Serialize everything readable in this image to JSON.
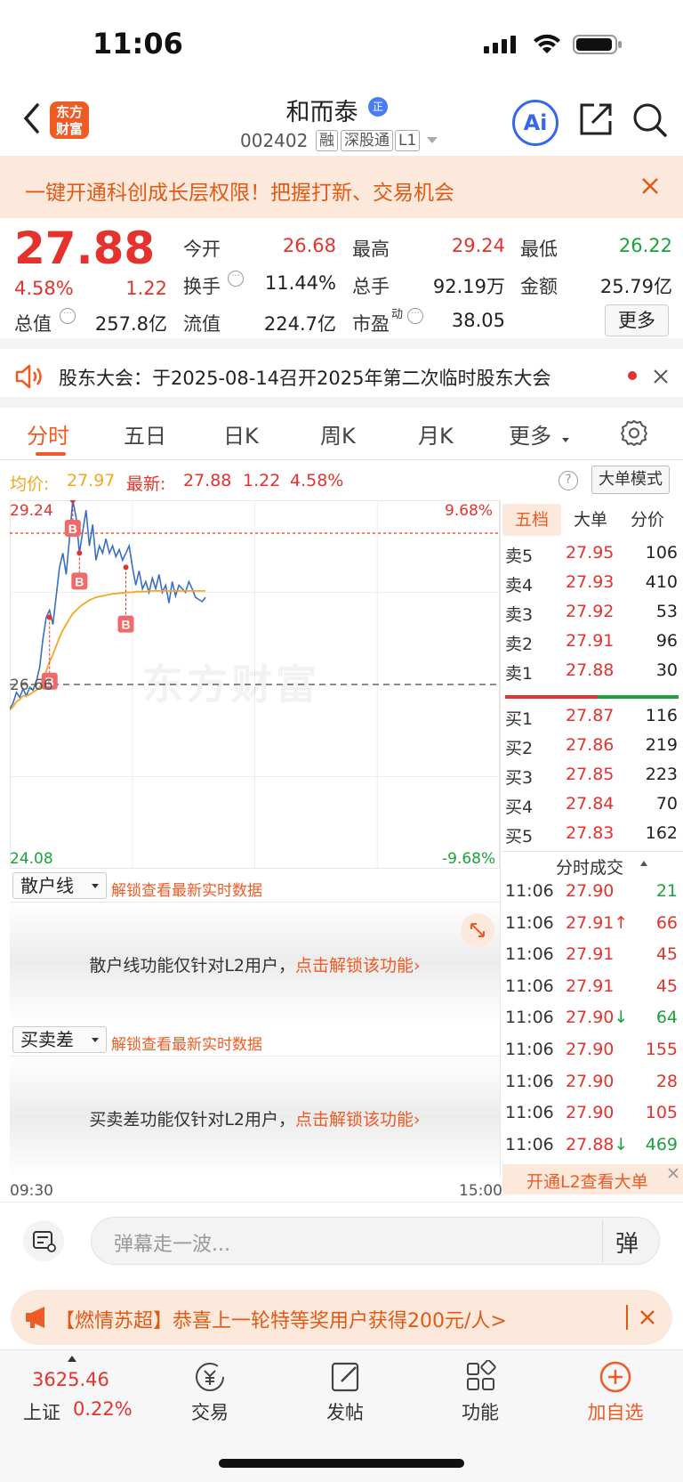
{
  "status_bar": {
    "time": "11:06"
  },
  "header": {
    "logo_text": "东方财富",
    "stock_name": "和而泰",
    "stock_code": "002402",
    "tags": [
      "融",
      "深股通",
      "L1"
    ],
    "zheng_badge": "正",
    "ai_label": "Ai"
  },
  "banner": {
    "text": "一键开通科创成长层权限！把握打新、交易机会"
  },
  "quote": {
    "price": "27.88",
    "change_pct": "4.58%",
    "change": "1.22",
    "fields": [
      {
        "label": "今开",
        "value": "26.68",
        "color": "#e5322d"
      },
      {
        "label": "最高",
        "value": "29.24",
        "color": "#e5322d"
      },
      {
        "label": "最低",
        "value": "26.22",
        "color": "#1aa33a"
      },
      {
        "label": "换手",
        "value": "11.44%",
        "color": "#222222"
      },
      {
        "label": "总手",
        "value": "92.19万",
        "color": "#222222"
      },
      {
        "label": "金额",
        "value": "25.79亿",
        "color": "#222222"
      },
      {
        "label": "总值",
        "value": "257.8亿",
        "color": "#222222"
      },
      {
        "label": "流值",
        "value": "224.7亿",
        "color": "#222222"
      },
      {
        "label": "市盈",
        "value": "38.05",
        "color": "#222222"
      }
    ],
    "pe_superscript": "动",
    "more_label": "更多"
  },
  "notice": {
    "text": "股东大会：于2025-08-14召开2025年第二次临时股东大会"
  },
  "tabs": [
    "分时",
    "五日",
    "日K",
    "周K",
    "月K",
    "更多"
  ],
  "chart_header": {
    "avg_label": "均价:",
    "avg_value": "27.97",
    "latest_label": "最新:",
    "latest_value": "27.88",
    "change": "1.22",
    "change_pct": "4.58%",
    "big_order_mode": "大单模式",
    "help": "?"
  },
  "chart_data": {
    "type": "line",
    "title": "",
    "price_high": "29.24",
    "price_low": "24.08",
    "pct_high": "9.68%",
    "pct_low": "-9.68%",
    "prev_close_label": "26.66",
    "x_start": "09:30",
    "x_end": "15:00",
    "watermark": "东方财富",
    "ylim": [
      24.08,
      29.24
    ],
    "prev_close": 26.66,
    "limit_up": 29.24,
    "series": [
      {
        "color": "#3a6fc4",
        "values": [
          26.32,
          26.4,
          26.55,
          26.48,
          26.6,
          26.5,
          26.62,
          26.58,
          26.7,
          26.9,
          27.3,
          27.6,
          27.7,
          27.5,
          27.9,
          28.3,
          28.5,
          28.2,
          28.7,
          29.24,
          29.0,
          28.5,
          28.8,
          29.1,
          28.6,
          28.9,
          28.4,
          28.6,
          28.5,
          28.7,
          28.5,
          28.6,
          28.45,
          28.55,
          28.4,
          28.5,
          28.6,
          28.3,
          28.05,
          28.25,
          28.0,
          28.1,
          27.95,
          28.15,
          28.0,
          28.2,
          27.95,
          28.05,
          27.8,
          28.1,
          27.9,
          28.05,
          28.0,
          27.95,
          28.1,
          28.0,
          27.88,
          27.85,
          27.82,
          27.88
        ]
      },
      {
        "color": "#f5a623",
        "values": [
          26.3,
          26.35,
          26.42,
          26.45,
          26.5,
          26.5,
          26.52,
          26.55,
          26.58,
          26.62,
          26.72,
          26.85,
          26.98,
          27.08,
          27.2,
          27.32,
          27.42,
          27.5,
          27.58,
          27.65,
          27.7,
          27.74,
          27.78,
          27.81,
          27.84,
          27.86,
          27.88,
          27.89,
          27.9,
          27.91,
          27.92,
          27.93,
          27.93,
          27.94,
          27.94,
          27.95,
          27.95,
          27.95,
          27.96,
          27.96,
          27.96,
          27.96,
          27.97,
          27.97,
          27.97,
          27.97,
          27.97,
          27.97,
          27.97,
          27.97,
          27.97,
          27.97,
          27.97,
          27.97,
          27.97,
          27.97,
          27.97,
          27.97,
          27.97,
          27.97
        ]
      }
    ],
    "buy_markers": [
      {
        "index": 12,
        "price": 27.6,
        "label": "B"
      },
      {
        "index": 19,
        "price": 29.24,
        "label": "B"
      },
      {
        "index": 21,
        "price": 28.5,
        "label": "B"
      },
      {
        "index": 35,
        "price": 28.3,
        "label": "B"
      }
    ]
  },
  "orderbook": {
    "tabs": [
      "五档",
      "大单",
      "分价"
    ],
    "asks": [
      {
        "label": "卖5",
        "price": "27.95",
        "vol": "106"
      },
      {
        "label": "卖4",
        "price": "27.93",
        "vol": "410"
      },
      {
        "label": "卖3",
        "price": "27.92",
        "vol": "53"
      },
      {
        "label": "卖2",
        "price": "27.91",
        "vol": "96"
      },
      {
        "label": "卖1",
        "price": "27.88",
        "vol": "30"
      }
    ],
    "bids": [
      {
        "label": "买1",
        "price": "27.87",
        "vol": "116"
      },
      {
        "label": "买2",
        "price": "27.86",
        "vol": "219"
      },
      {
        "label": "买3",
        "price": "27.85",
        "vol": "223"
      },
      {
        "label": "买4",
        "price": "27.84",
        "vol": "70"
      },
      {
        "label": "买5",
        "price": "27.83",
        "vol": "162"
      }
    ]
  },
  "trades": {
    "title": "分时成交",
    "rows": [
      {
        "time": "11:06",
        "price": "27.90",
        "vol": "21",
        "color": "#1aa33a"
      },
      {
        "time": "11:06",
        "price": "27.91↑",
        "vol": "66",
        "color": "#e5322d"
      },
      {
        "time": "11:06",
        "price": "27.91",
        "vol": "45",
        "color": "#e5322d"
      },
      {
        "time": "11:06",
        "price": "27.91",
        "vol": "45",
        "color": "#e5322d"
      },
      {
        "time": "11:06",
        "price": "27.90↓",
        "vol": "64",
        "color": "#1aa33a"
      },
      {
        "time": "11:06",
        "price": "27.90",
        "vol": "155",
        "color": "#e5322d"
      },
      {
        "time": "11:06",
        "price": "27.90",
        "vol": "28",
        "color": "#e5322d"
      },
      {
        "time": "11:06",
        "price": "27.90",
        "vol": "105",
        "color": "#e5322d"
      },
      {
        "time": "11:06",
        "price": "27.88↓",
        "vol": "469",
        "color": "#1aa33a"
      }
    ],
    "l2_label": "开通L2查看大单"
  },
  "sub_panels": [
    {
      "selector": "散户线",
      "unlock": "解锁查看最新实时数据",
      "msg": "散户线功能仅针对L2用户，",
      "link": "点击解锁该功能"
    },
    {
      "selector": "买卖差",
      "unlock": "解锁查看最新实时数据",
      "msg": "买卖差功能仅针对L2用户，",
      "link": "点击解锁该功能"
    }
  ],
  "danmu": {
    "placeholder": "弹幕走一波...",
    "button": "弹"
  },
  "promo": {
    "text": "【燃情苏超】恭喜上一轮特等奖用户获得200元/人>"
  },
  "bottom_nav": {
    "index_value": "3625.46",
    "index_name": "上证",
    "index_change": "0.22%",
    "items": [
      "交易",
      "发帖",
      "功能",
      "加自选"
    ]
  }
}
